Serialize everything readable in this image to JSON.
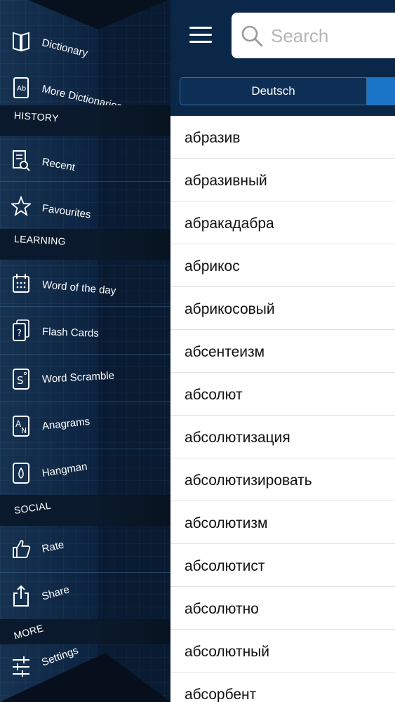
{
  "sidebar": {
    "items": {
      "dictionary": {
        "label": "Dictionary",
        "icon": "book-icon"
      },
      "more_dictionaries": {
        "label": "More Dictionaries",
        "icon": "dictionary-ab-icon"
      },
      "recent": {
        "label": "Recent",
        "icon": "recent-search-icon"
      },
      "favourites": {
        "label": "Favourites",
        "icon": "star-icon"
      },
      "word_of_the_day": {
        "label": "Word of the day",
        "icon": "calendar-icon"
      },
      "flash_cards": {
        "label": "Flash Cards",
        "icon": "flash-cards-icon"
      },
      "word_scramble": {
        "label": "Word Scramble",
        "icon": "word-scramble-icon"
      },
      "anagrams": {
        "label": "Anagrams",
        "icon": "anagrams-icon"
      },
      "hangman": {
        "label": "Hangman",
        "icon": "hangman-icon"
      },
      "rate": {
        "label": "Rate",
        "icon": "thumbs-up-icon"
      },
      "share": {
        "label": "Share",
        "icon": "share-icon"
      },
      "settings": {
        "label": "Settings",
        "icon": "sliders-icon"
      }
    },
    "sections": {
      "history": "HISTORY",
      "learning": "LEARNING",
      "social": "SOCIAL",
      "more": "MORE"
    }
  },
  "header": {
    "search_placeholder": "Search",
    "tabs": [
      "Deutsch",
      ""
    ]
  },
  "words": [
    "абразив",
    "абразивный",
    "абракадабра",
    "абрикос",
    "абрикосовый",
    "абсентеизм",
    "абсолют",
    "абсолютизация",
    "абсолютизировать",
    "абсолютизм",
    "абсолютист",
    "абсолютно",
    "абсолютный",
    "абсорбент"
  ],
  "colors": {
    "header": "#0b2747",
    "accent": "#1a74c8",
    "sidebar": "#0b2340"
  }
}
